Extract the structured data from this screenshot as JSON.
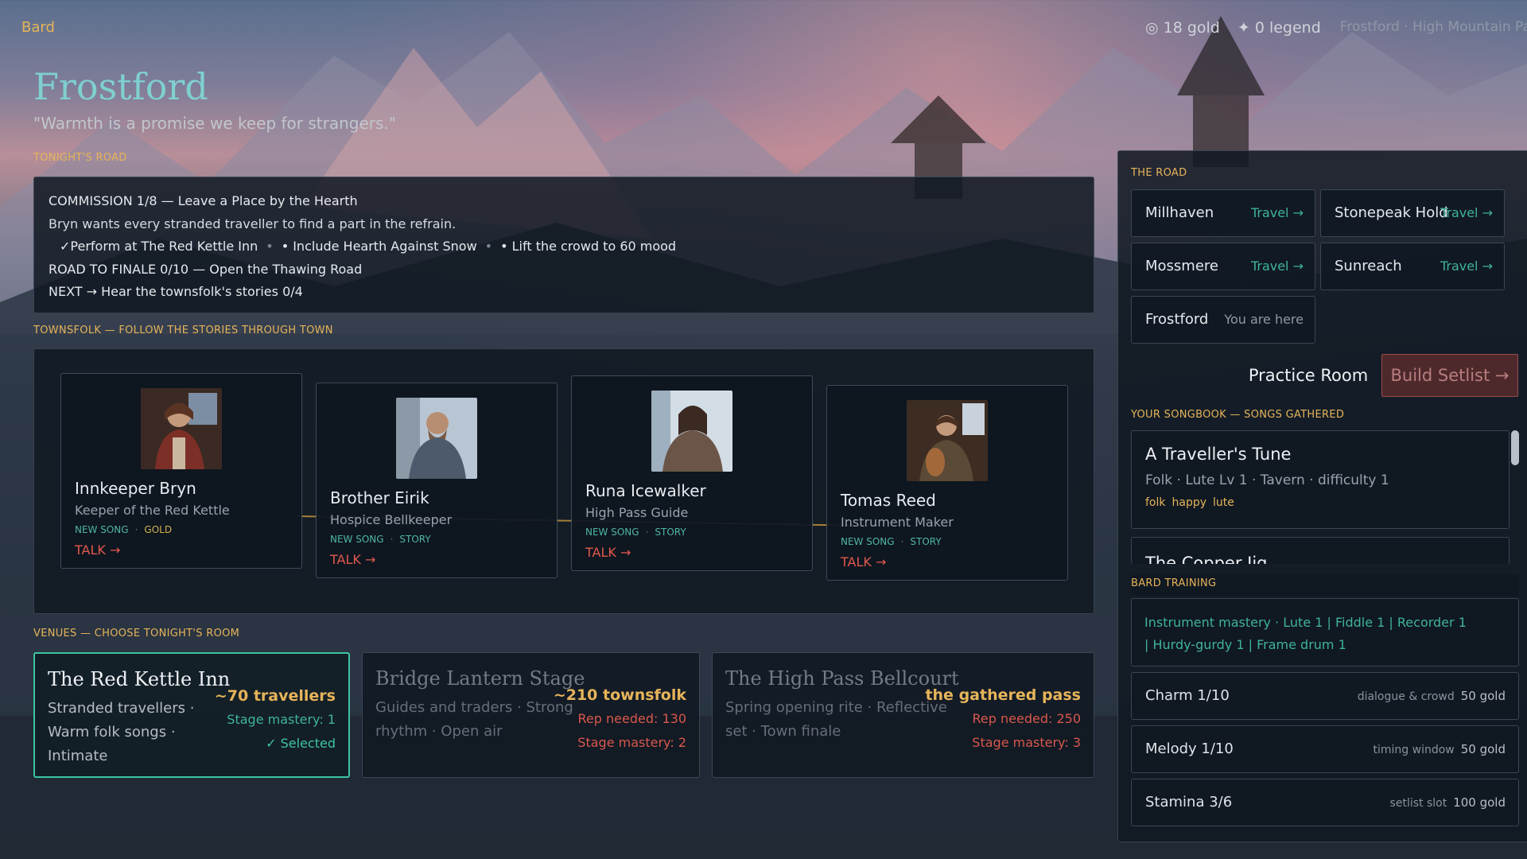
{
  "hud": {
    "class_label": "Bard",
    "gold": "◎ 18 gold",
    "legend": "✦ 0 legend",
    "location": "Frostford · High Mountain Pa"
  },
  "town": {
    "name": "Frostford",
    "quote": "\"Warmth is a promise we keep for strangers.\""
  },
  "sections": {
    "tonights_road": "TONIGHT'S ROAD",
    "townsfolk": "TOWNSFOLK — FOLLOW THE STORIES THROUGH TOWN",
    "venues": "VENUES — CHOOSE TONIGHT'S ROOM",
    "the_road": "THE ROAD",
    "songbook": "YOUR SONGBOOK — SONGS GATHERED",
    "training": "BARD TRAINING"
  },
  "road": {
    "commission": "COMMISSION 1/8 — Leave a Place by the Hearth",
    "description": "Bryn wants every stranded traveller to find a part in the refrain.",
    "objectives": [
      "✓Perform at The Red Kettle Inn",
      "•",
      "• Include Hearth Against Snow",
      "•",
      "• Lift the crowd to 60 mood"
    ],
    "finale": "ROAD TO FINALE 0/10 — Open the Thawing Road",
    "next": "NEXT  →  Hear the townsfolk's stories 0/4"
  },
  "townsfolk": [
    {
      "name": "Innkeeper Bryn",
      "role": "Keeper of the Red Kettle",
      "tag1": "NEW SONG",
      "dot": "·",
      "tag2": "GOLD",
      "talk": "TALK  →"
    },
    {
      "name": "Brother Eirik",
      "role": "Hospice Bellkeeper",
      "tag1": "NEW SONG",
      "dot": "·",
      "tag2": "STORY",
      "talk": "TALK  →"
    },
    {
      "name": "Runa Icewalker",
      "role": "High Pass Guide",
      "tag1": "NEW SONG",
      "dot": "·",
      "tag2": "STORY",
      "talk": "TALK  →"
    },
    {
      "name": "Tomas Reed",
      "role": "Instrument Maker",
      "tag1": "NEW SONG",
      "dot": "·",
      "tag2": "STORY",
      "talk": "TALK  →"
    }
  ],
  "venues": [
    {
      "name": "The Red Kettle Inn",
      "desc1": "Stranded travellers ·",
      "desc2": "Warm folk songs ·",
      "desc3": "Intimate",
      "crowd": "~70 travellers",
      "line1": "Stage mastery: 1",
      "line2": "✓ Selected"
    },
    {
      "name": "Bridge Lantern Stage",
      "desc1": "Guides and traders · Strong",
      "desc2": "rhythm · Open air",
      "desc3": "",
      "crowd": "~210 townsfolk",
      "line1": "Rep needed: 130",
      "line2": "Stage mastery: 2"
    },
    {
      "name": "The High Pass Bellcourt",
      "desc1": "Spring opening rite · Reflective",
      "desc2": "set · Town finale",
      "desc3": "",
      "crowd": "the gathered pass",
      "line1": "Rep needed: 250",
      "line2": "Stage mastery: 3"
    }
  ],
  "routes": [
    {
      "name": "Millhaven",
      "action": "Travel →"
    },
    {
      "name": "Stonepeak Hold",
      "action": "Travel →"
    },
    {
      "name": "Mossmere",
      "action": "Travel →"
    },
    {
      "name": "Sunreach",
      "action": "Travel →"
    },
    {
      "name": "Frostford",
      "action": "You are here"
    }
  ],
  "actions": {
    "practice": "Practice Room",
    "setlist": "Build Setlist →"
  },
  "songbook": [
    {
      "title": "A Traveller's Tune",
      "meta": "Folk · Lute Lv 1 · Tavern · difficulty 1",
      "tags": [
        "folk",
        "happy",
        "lute"
      ]
    },
    {
      "title": "The Copper Jig"
    }
  ],
  "training": {
    "mastery_line1": "Instrument mastery  ·  Lute 1  |  Fiddle 1  |  Recorder 1",
    "mastery_line2": "|  Hurdy-gurdy 1  |  Frame drum 1",
    "stats": [
      {
        "name": "Charm  1/10",
        "effect": "dialogue & crowd",
        "cost": "50 gold"
      },
      {
        "name": "Melody  1/10",
        "effect": "timing window",
        "cost": "50 gold"
      },
      {
        "name": "Stamina  3/6",
        "effect": "setlist slot",
        "cost": "100 gold"
      }
    ]
  },
  "colors": {
    "accent_gold": "#e6b45a",
    "accent_teal": "#3fb39a",
    "title_teal": "#7fd0cf",
    "talk_red": "#e2594d",
    "selected_border": "#3cc4a1"
  }
}
